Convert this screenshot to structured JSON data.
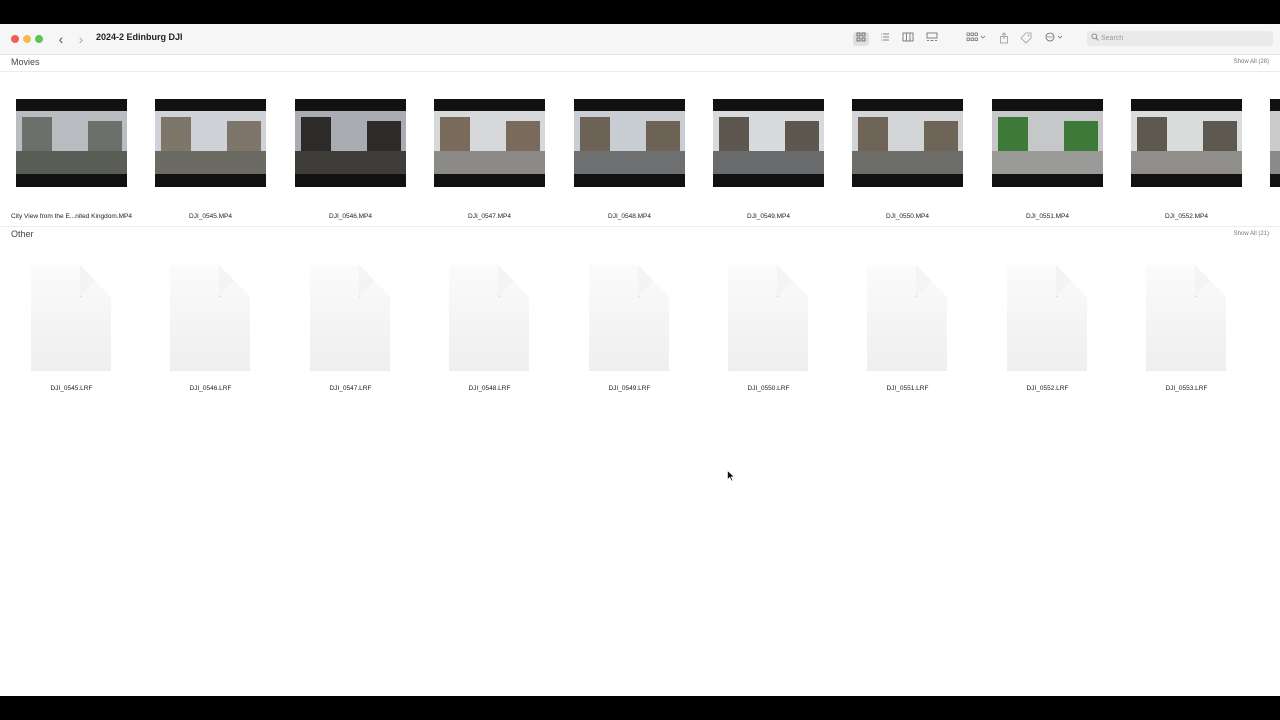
{
  "window": {
    "title": "2024-2 Edinburg DJI"
  },
  "toolbar": {
    "nav_back": "‹",
    "nav_forward": "›",
    "icons": [
      "icon-view-icon",
      "list-view-icon",
      "column-view-icon",
      "gallery-view-icon",
      "group-icon",
      "share-icon",
      "tag-icon",
      "more-actions-icon"
    ],
    "search_placeholder": "Search"
  },
  "sections": {
    "movies": {
      "title": "Movies",
      "show_all": "Show All (28)",
      "items": [
        {
          "label": "City View from the E...nited Kingdom.MP4",
          "sky": "#b9bcc0",
          "ground": "#5a5d55",
          "bldg": "#6d6f6a"
        },
        {
          "label": "DJI_0545.MP4",
          "sky": "#cfd2d6",
          "ground": "#6b6a63",
          "bldg": "#7e766a"
        },
        {
          "label": "DJI_0546.MP4",
          "sky": "#a9adb2",
          "ground": "#3e3d3a",
          "bldg": "#2c2b29"
        },
        {
          "label": "DJI_0547.MP4",
          "sky": "#d6d8da",
          "ground": "#8c8a86",
          "bldg": "#7a6a5c"
        },
        {
          "label": "DJI_0548.MP4",
          "sky": "#c9ced4",
          "ground": "#6e6f71",
          "bldg": "#6d6256"
        },
        {
          "label": "DJI_0549.MP4",
          "sky": "#d8dadc",
          "ground": "#6a6b6c",
          "bldg": "#5e574f"
        },
        {
          "label": "DJI_0550.MP4",
          "sky": "#d2d4d6",
          "ground": "#6c6c68",
          "bldg": "#6f6458"
        },
        {
          "label": "DJI_0551.MP4",
          "sky": "#c5c7c8",
          "ground": "#9a9a98",
          "bldg": "#3d7a3a"
        },
        {
          "label": "DJI_0552.MP4",
          "sky": "#dadcdc",
          "ground": "#8f8e8a",
          "bldg": "#5d5850"
        }
      ]
    },
    "other": {
      "title": "Other",
      "show_all": "Show All (21)",
      "items": [
        {
          "label": "DJI_0545.LRF"
        },
        {
          "label": "DJI_0546.LRF"
        },
        {
          "label": "DJI_0547.LRF"
        },
        {
          "label": "DJI_0548.LRF"
        },
        {
          "label": "DJI_0549.LRF"
        },
        {
          "label": "DJI_0550.LRF"
        },
        {
          "label": "DJI_0551.LRF"
        },
        {
          "label": "DJI_0552.LRF"
        },
        {
          "label": "DJI_0553.LRF"
        }
      ]
    }
  }
}
